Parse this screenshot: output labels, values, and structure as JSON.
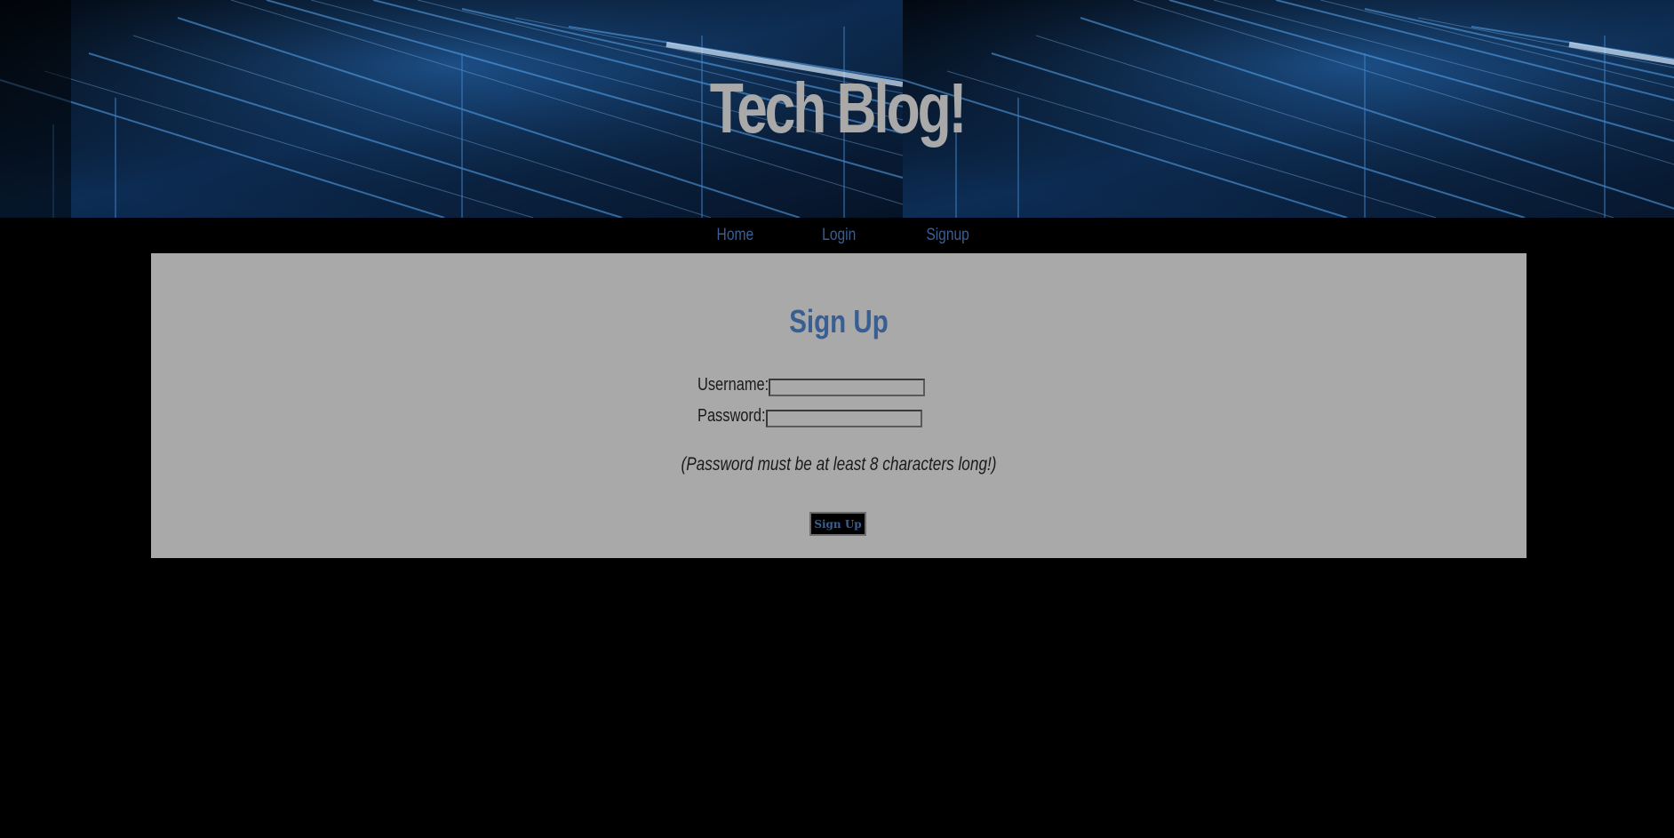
{
  "header": {
    "title": "Tech Blog!"
  },
  "nav": {
    "items": [
      {
        "label": "Home"
      },
      {
        "label": "Login"
      },
      {
        "label": "Signup"
      }
    ]
  },
  "signup": {
    "heading": "Sign Up",
    "username_label": "Username:",
    "username_value": "",
    "password_label": "Password:",
    "password_value": "",
    "hint": "(Password must be at least 8 characters long!)",
    "submit_label": "Sign Up"
  },
  "colors": {
    "background": "#000000",
    "panel": "#a9a9a9",
    "accent": "#3a5f94",
    "title": "#a9a9a9"
  }
}
